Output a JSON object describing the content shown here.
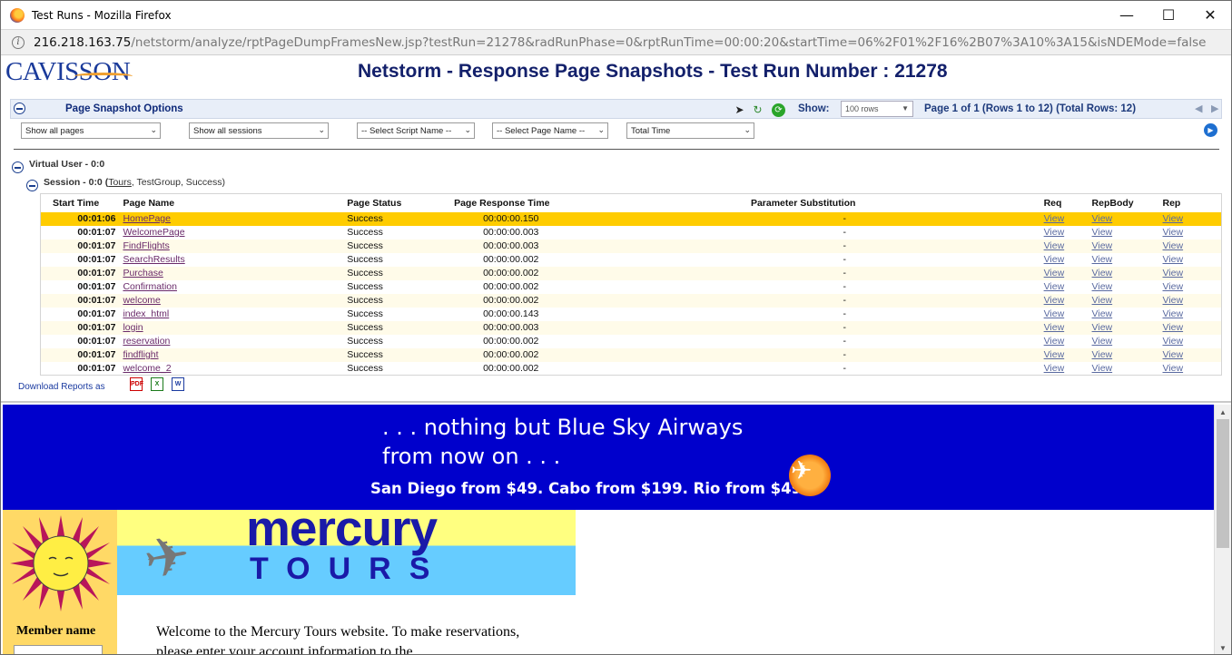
{
  "window": {
    "title": "Test Runs - Mozilla Firefox",
    "url_host": "216.218.163.75",
    "url_path": "/netstorm/analyze/rptPageDumpFramesNew.jsp?testRun=21278&radRunPhase=0&rptRunTime=00:00:20&startTime=06%2F01%2F16%2B07%3A10%3A15&isNDEMode=false"
  },
  "header": {
    "logo": "CAVISSON",
    "title": "Netstorm - Response Page Snapshots - Test Run Number : 21278"
  },
  "options": {
    "title": "Page Snapshot Options",
    "show_label": "Show:",
    "rows_value": "100 rows",
    "page_info": "Page 1 of 1 (Rows 1 to 12) (Total Rows: 12)"
  },
  "filters": {
    "pages": "Show all pages",
    "sessions": "Show all sessions",
    "script": "-- Select Script Name --",
    "page": "-- Select Page Name --",
    "time": "Total Time"
  },
  "tree": {
    "virtual_user": "Virtual User - 0:0",
    "session_prefix": "Session - 0:0 (",
    "session_link": "Tours",
    "session_suffix": ", TestGroup, Success)"
  },
  "table": {
    "headers": [
      "Start Time",
      "Page Name",
      "Page Status",
      "Page Response Time",
      "Parameter Substitution",
      "Req",
      "RepBody",
      "Rep"
    ],
    "rows": [
      [
        "00:01:06",
        "HomePage",
        "Success",
        "00:00:00.150",
        "-",
        "View",
        "View",
        "View"
      ],
      [
        "00:01:07",
        "WelcomePage",
        "Success",
        "00:00:00.003",
        "-",
        "View",
        "View",
        "View"
      ],
      [
        "00:01:07",
        "FindFlights",
        "Success",
        "00:00:00.003",
        "-",
        "View",
        "View",
        "View"
      ],
      [
        "00:01:07",
        "SearchResults",
        "Success",
        "00:00:00.002",
        "-",
        "View",
        "View",
        "View"
      ],
      [
        "00:01:07",
        "Purchase",
        "Success",
        "00:00:00.002",
        "-",
        "View",
        "View",
        "View"
      ],
      [
        "00:01:07",
        "Confirmation",
        "Success",
        "00:00:00.002",
        "-",
        "View",
        "View",
        "View"
      ],
      [
        "00:01:07",
        "welcome",
        "Success",
        "00:00:00.002",
        "-",
        "View",
        "View",
        "View"
      ],
      [
        "00:01:07",
        "index_html",
        "Success",
        "00:00:00.143",
        "-",
        "View",
        "View",
        "View"
      ],
      [
        "00:01:07",
        "login",
        "Success",
        "00:00:00.003",
        "-",
        "View",
        "View",
        "View"
      ],
      [
        "00:01:07",
        "reservation",
        "Success",
        "00:00:00.002",
        "-",
        "View",
        "View",
        "View"
      ],
      [
        "00:01:07",
        "findflight",
        "Success",
        "00:00:00.002",
        "-",
        "View",
        "View",
        "View"
      ],
      [
        "00:01:07",
        "welcome_2",
        "Success",
        "00:00:00.002",
        "-",
        "View",
        "View",
        "View"
      ]
    ]
  },
  "download": {
    "label": "Download Reports as",
    "pdf": "PDF",
    "excel": "X",
    "word": "W"
  },
  "snapshot": {
    "banner_line1": ". . . nothing but Blue Sky Airways",
    "banner_line2": "from now on . . .",
    "banner_line3": "San Diego from $49. Cabo from $199. Rio from $499.",
    "logo_top": "mercury",
    "logo_bottom": "TOURS",
    "member_label": "Member name",
    "welcome_text": "Welcome to the Mercury Tours website. To make reservations, please enter your account information to the"
  }
}
